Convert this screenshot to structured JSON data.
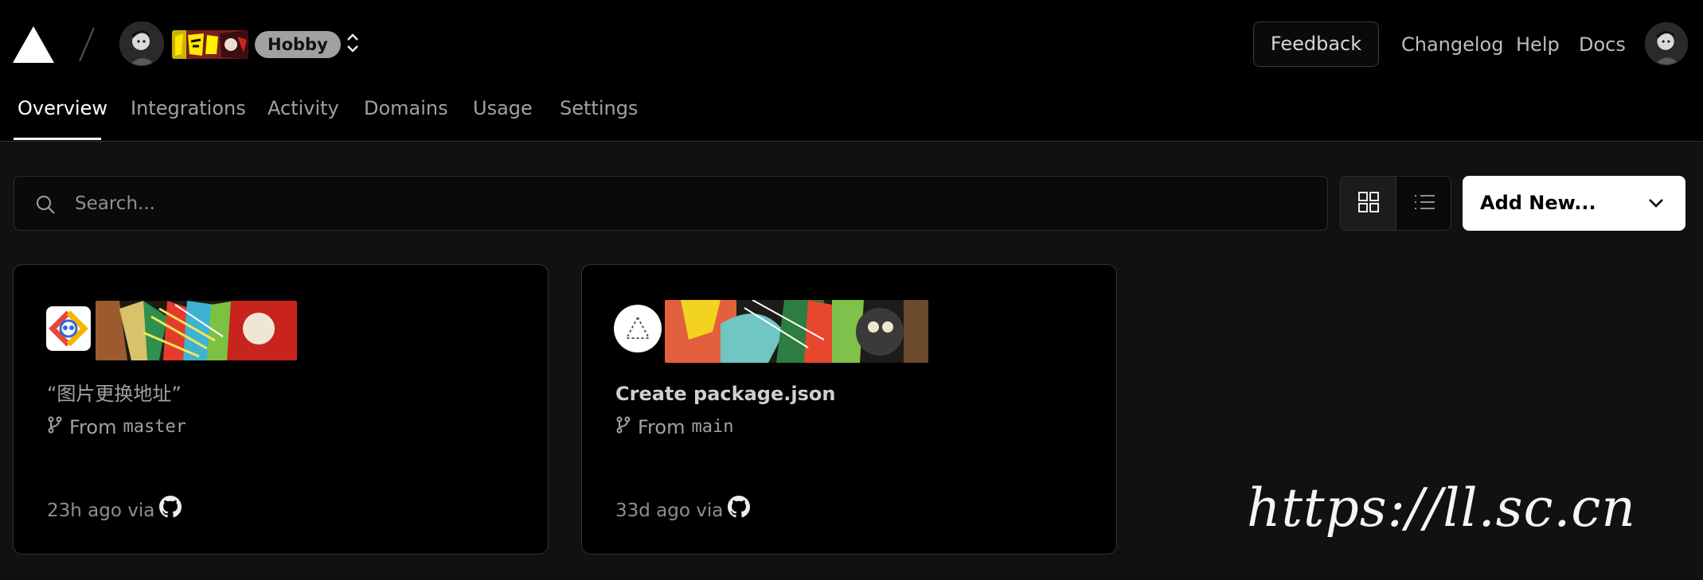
{
  "team": {
    "plan_badge": "Hobby"
  },
  "header": {
    "feedback_label": "Feedback",
    "links": [
      "Changelog",
      "Help",
      "Docs"
    ]
  },
  "tabs": [
    {
      "label": "Overview",
      "active": true
    },
    {
      "label": "Integrations",
      "active": false
    },
    {
      "label": "Activity",
      "active": false
    },
    {
      "label": "Domains",
      "active": false
    },
    {
      "label": "Usage",
      "active": false
    },
    {
      "label": "Settings",
      "active": false
    }
  ],
  "toolbar": {
    "search_placeholder": "Search...",
    "add_new_label": "Add New...",
    "view_mode": "grid"
  },
  "projects": [
    {
      "icon": "project-logo-icon",
      "title": "“图片更换地址”",
      "branch_prefix": "From",
      "branch": "master",
      "time": "23h ago via",
      "source_icon": "github-icon"
    },
    {
      "icon": "vercel-placeholder-icon",
      "title": "Create package.json",
      "branch_prefix": "From",
      "branch": "main",
      "time": "33d ago via",
      "source_icon": "github-icon"
    }
  ],
  "watermark": "https://ll.sc.cn",
  "colors": {
    "background": "#111111",
    "surface": "#000000",
    "border": "#333333",
    "muted_text": "#a1a1a1",
    "primary_button": "#ffffff"
  }
}
